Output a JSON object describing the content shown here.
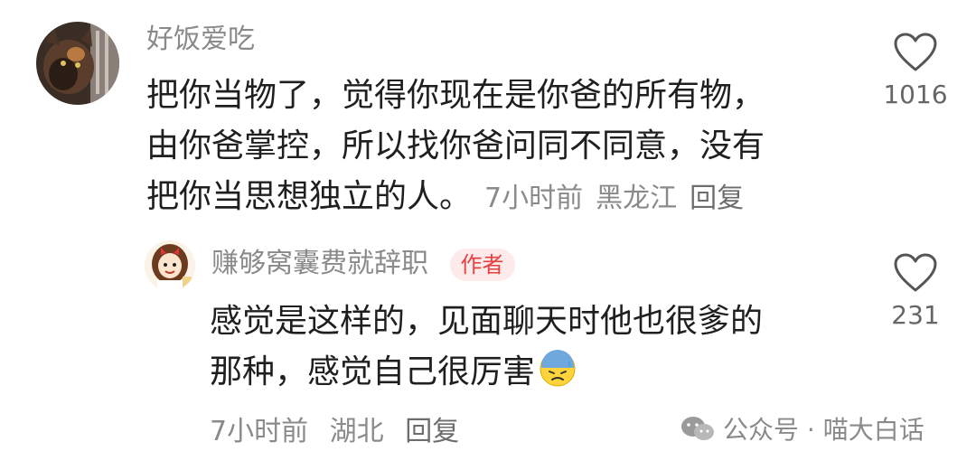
{
  "comment": {
    "username": "好饭爱吃",
    "lines": [
      "把你当物了，觉得你现在是你爸的所有物，",
      "由你爸掌控，所以找你爸问同不同意，没有",
      "把你当思想独立的人。"
    ],
    "time": "7小时前",
    "location": "黑龙江",
    "reply_label": "回复",
    "like_count": "1016",
    "avatar_icon": "cat-photo-avatar"
  },
  "reply": {
    "username": "赚够窝囊费就辞职",
    "badge": "作者",
    "lines": [
      "感觉是这样的，见面聊天时他也很爹的",
      "那种，感觉自己很厉害"
    ],
    "emoji_icon": "cold-sweat-emoji-icon",
    "time": "7小时前",
    "location": "湖北",
    "reply_label": "回复",
    "like_count": "231",
    "avatar_icon": "cartoon-girl-avatar"
  },
  "watermark": {
    "text": "公众号 · 喵大白话",
    "icon": "wechat-icon"
  },
  "colors": {
    "meta_gray": "#8a8a8a",
    "text": "#1f1f1f",
    "badge_bg": "#fdeaea",
    "badge_text": "#e84040"
  }
}
